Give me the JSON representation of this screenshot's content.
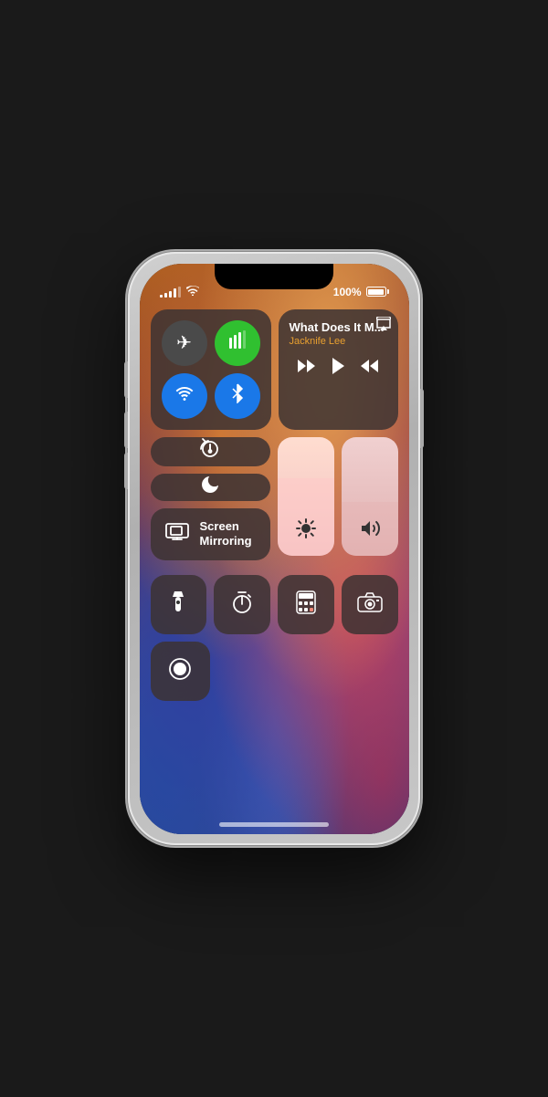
{
  "phone": {
    "status": {
      "signal_bars": 4,
      "battery_percent": "100%",
      "wifi": true
    }
  },
  "control_center": {
    "connectivity": {
      "airplane_label": "Airplane Mode",
      "cellular_label": "Cellular",
      "wifi_label": "Wi-Fi",
      "bluetooth_label": "Bluetooth"
    },
    "now_playing": {
      "title": "What Does It M...",
      "artist": "Jacknife Lee",
      "airplay_label": "AirPlay"
    },
    "buttons": {
      "rotation_lock": "Rotation Lock",
      "do_not_disturb": "Do Not Disturb",
      "screen_mirroring": "Screen\nMirroring",
      "brightness": "Brightness",
      "volume": "Volume",
      "flashlight": "Flashlight",
      "timer": "Timer",
      "calculator": "Calculator",
      "camera": "Camera",
      "screen_record": "Screen Record"
    }
  },
  "icons": {
    "airplane": "✈",
    "cellular": "📶",
    "wifi": "📶",
    "bluetooth": "❄",
    "rewind": "«",
    "play": "▶",
    "fast_forward": "»",
    "rotation": "⊙",
    "moon": "☽",
    "mirror": "▭",
    "brightness": "☀",
    "volume": "🔊",
    "flashlight": "🔦",
    "timer": "⏱",
    "calculator": "🖩",
    "camera": "📷",
    "record": "⏺"
  }
}
